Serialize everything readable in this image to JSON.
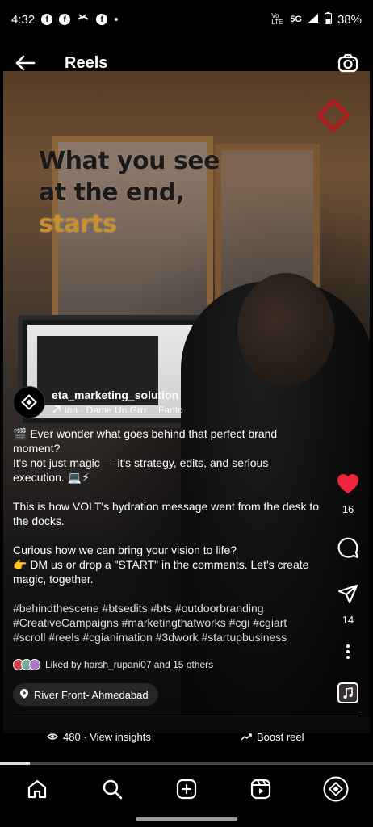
{
  "status_bar": {
    "time": "4:32",
    "network": "5G",
    "volte": "Vo LTE",
    "battery": "38%"
  },
  "header": {
    "title": "Reels"
  },
  "video": {
    "overlay_lines": [
      "What you see",
      "at the end,",
      "starts"
    ]
  },
  "author": {
    "username": "eta_marketing_solution",
    "audio": "inn · Dame Un Grrr",
    "audio_extra": "Fanto"
  },
  "caption": {
    "p1": "🎬 Ever wonder what goes behind that perfect brand moment?",
    "p1b": "It's not just magic — it's strategy, edits, and serious execution. 💻⚡",
    "p2": "This is how VOLT's hydration message went from the desk to the docks.",
    "p3": "Curious how we can bring your vision to life?",
    "p3b": "👉 DM us or drop a \"START\" in the comments. Let's create magic, together.",
    "hashtags": "#behindthescene #btsedits #bts #outdoorbranding #CreativeCampaigns #marketingthatworks #cgi #cgiart #scroll #reels #cgianimation #3dwork #startupbusiness"
  },
  "liked_by": "Liked by harsh_rupani07 and 15 others",
  "location": "River Front- Ahmedabad",
  "insights": {
    "label": "480 · View insights"
  },
  "boost": {
    "label": "Boost reel"
  },
  "actions": {
    "likes": "16",
    "shares": "14"
  },
  "progress": {
    "fraction": 0.08
  },
  "colors": {
    "like": "#f0243b",
    "accent_text": "#c8902e"
  }
}
